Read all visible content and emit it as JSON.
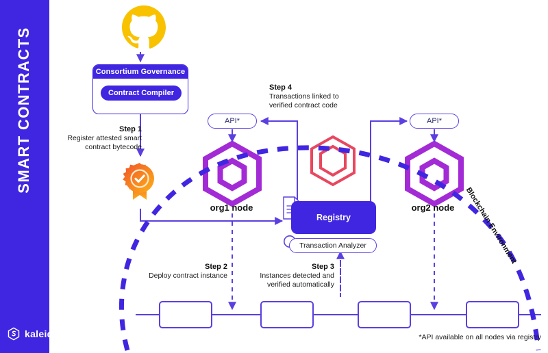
{
  "sidebar": {
    "title": "SMART CONTRACTS",
    "brand": "kaleido",
    "brand_icon": "kaleido-hex-logo-icon",
    "color": "#4026e0"
  },
  "source": {
    "icon": "github-logo-icon",
    "icon_color": "#f8c200"
  },
  "governance": {
    "header": "Consortium Governance",
    "compiler_button": "Contract Compiler"
  },
  "steps": [
    {
      "id": "step1",
      "head": "Step 1",
      "body": "Register attested smart\ncontract bytecode",
      "line1": "Register attested smart",
      "line2": "contract bytecode"
    },
    {
      "id": "step2",
      "head": "Step 2",
      "line1": "Deploy contract  instance",
      "line2": ""
    },
    {
      "id": "step3",
      "head": "Step 3",
      "line1": "Instances detected and",
      "line2": "verified automatically"
    },
    {
      "id": "step4",
      "head": "Step 4",
      "line1": "Transactions linked to",
      "line2": "verified contract code"
    }
  ],
  "attestation": {
    "icon": "award-ribbon-check-icon",
    "color_start": "#f25c2a",
    "color_end": "#fcaf17"
  },
  "nodes": [
    {
      "id": "org1",
      "label": "org1 node",
      "api_label": "API*",
      "icon": "hexagon-node-icon",
      "color": "#a32bd6"
    },
    {
      "id": "org2",
      "label": "org2 node",
      "api_label": "API*",
      "icon": "hexagon-node-icon",
      "color": "#a32bd6"
    }
  ],
  "registry": {
    "title": "Registry",
    "hex_icon": "hexagon-registry-icon",
    "hex_color": "#e8475f",
    "doc_icon": "document-list-icon",
    "analyzer_label": "Transaction Analyzer",
    "analyzer_icon": "magnifier-icon"
  },
  "blockchain": {
    "env_label": "Blockchain Environment",
    "block_count": 4,
    "line_color": "#5b3fe0"
  },
  "footer": {
    "note": "*API available on all nodes via registry"
  },
  "palette": {
    "primary": "#4026e0",
    "stroke": "#5b3fe0",
    "node": "#a32bd6",
    "registry_hex": "#e8475f",
    "github": "#f8c200"
  }
}
